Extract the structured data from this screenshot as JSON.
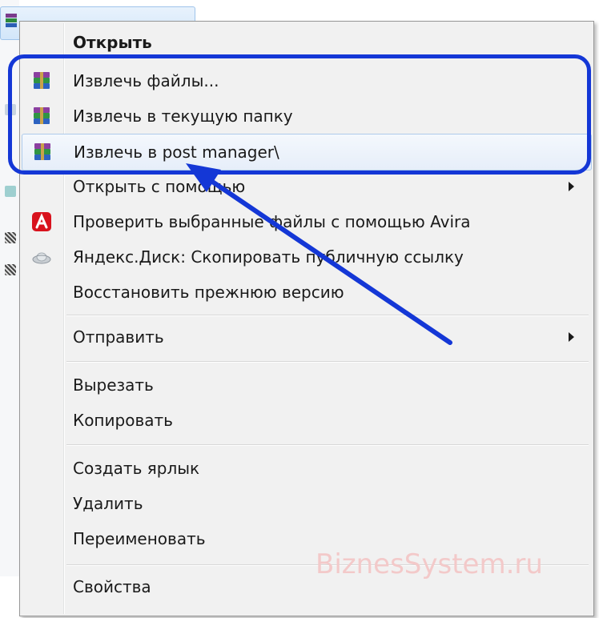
{
  "background": {
    "selected_file_label": ""
  },
  "context_menu": {
    "items": [
      {
        "label": "Открыть",
        "icon": "",
        "bold": true
      },
      {
        "label": "Извлечь файлы...",
        "icon": "winrar-icon"
      },
      {
        "label": "Извлечь в текущую папку",
        "icon": "winrar-icon"
      },
      {
        "label": "Извлечь в post manager\\",
        "icon": "winrar-icon",
        "hover": true
      },
      {
        "label": "Открыть с помощью",
        "icon": "",
        "submenu": true
      },
      {
        "label": "Проверить выбранные файлы с помощью Avira",
        "icon": "avira-icon"
      },
      {
        "label": "Яндекс.Диск: Скопировать публичную ссылку",
        "icon": "yandex-disk-icon"
      },
      {
        "label": "Восстановить прежнюю версию",
        "icon": ""
      },
      {
        "label": "Отправить",
        "icon": "",
        "submenu": true
      },
      {
        "label": "Вырезать",
        "icon": ""
      },
      {
        "label": "Копировать",
        "icon": ""
      },
      {
        "label": "Создать ярлык",
        "icon": ""
      },
      {
        "label": "Удалить",
        "icon": ""
      },
      {
        "label": "Переименовать",
        "icon": ""
      },
      {
        "label": "Свойства",
        "icon": ""
      }
    ]
  },
  "annotation": {
    "highlight_color": "#1437d6",
    "arrow_color": "#1437d6"
  },
  "watermark": {
    "text": "BiznesSystem.ru",
    "color": "#f3c9c9"
  }
}
